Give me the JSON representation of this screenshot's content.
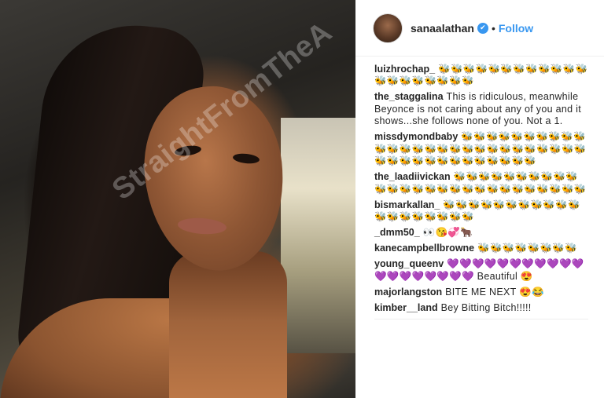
{
  "photo": {
    "watermark": "StraightFromTheA"
  },
  "post": {
    "username": "sanaalathan",
    "verified_icon": "✔",
    "separator": "•",
    "follow_label": "Follow"
  },
  "comments": [
    {
      "user": "luizhrochap_",
      "text": "🐝🐝🐝🐝🐝🐝🐝🐝🐝🐝🐝🐝🐝🐝🐝🐝🐝🐝🐝🐝"
    },
    {
      "user": "the_staggalina",
      "text": "This is ridiculous, meanwhile Beyonce is not caring about any of you and it shows...she follows none of you. Not a 1."
    },
    {
      "user": "missdymondbaby",
      "text": "🐝🐝🐝🐝🐝🐝🐝🐝🐝🐝🐝🐝🐝🐝🐝🐝🐝🐝🐝🐝🐝🐝🐝🐝🐝🐝🐝🐝🐝🐝🐝🐝🐝🐝🐝🐝🐝🐝🐝🐝"
    },
    {
      "user": "the_laadiivickan",
      "text": "🐝🐝🐝🐝🐝🐝🐝🐝🐝🐝🐝🐝🐝🐝🐝🐝🐝🐝🐝🐝🐝🐝🐝🐝🐝🐝🐝"
    },
    {
      "user": "bismarkallan_",
      "text": "🐝🐝🐝🐝🐝🐝🐝🐝🐝🐝🐝🐝🐝🐝🐝🐝🐝🐝🐝"
    },
    {
      "user": "_dmm50_",
      "text": "👀😘💞🐂"
    },
    {
      "user": "kanecampbellbrowne",
      "text": "🐝🐝🐝🐝🐝🐝🐝🐝"
    },
    {
      "user": "young_queenv",
      "text": "💜💜💜💜💜💜💜💜💜💜💜💜💜💜💜💜💜💜💜 Beautiful 😍"
    },
    {
      "user": "majorlangston",
      "text": "BITE ME NEXT 😍😂"
    },
    {
      "user": "kimber__land",
      "text": "Bey Bitting Bitch!!!!!"
    }
  ],
  "colors": {
    "accent": "#3897f0",
    "text": "#262626",
    "divider": "#efefef"
  }
}
